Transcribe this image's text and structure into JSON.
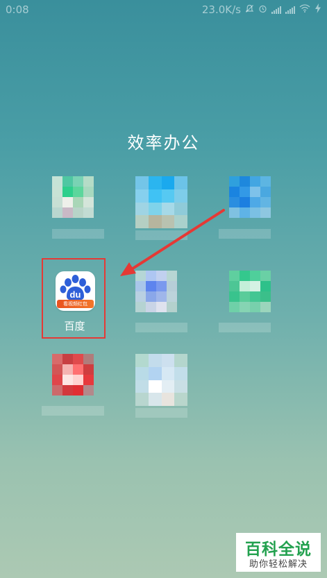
{
  "status_bar": {
    "time": "0:08",
    "network_speed": "23.0K/s",
    "icons": [
      "mute-icon",
      "alarm-icon",
      "signal-icon",
      "signal-icon",
      "wifi-icon",
      "charging-icon"
    ]
  },
  "folder": {
    "title": "效率办公"
  },
  "apps": {
    "baidu": {
      "label": "百度",
      "logo_text": "du",
      "banner_text": "看视频红包",
      "colors": {
        "paw": "#2e5fd8",
        "banner": "#ef6424"
      }
    },
    "pixelated": [
      {
        "name": "app-1",
        "colors": [
          "#c5e3d6",
          "#4fc7a2",
          "#79d3b4",
          "#b5dcc7",
          "#c8e2d5",
          "#2ecf8c",
          "#5cd69c",
          "#a8d9bf",
          "#c7dfd4",
          "#eef0ea",
          "#a9d6b7",
          "#d4e5da",
          "#b9d6cf",
          "#c9b9c6",
          "#b8d4c8",
          "#c2dcd3"
        ]
      },
      {
        "name": "app-2",
        "colors": [
          "#74c5e8",
          "#2bb5ef",
          "#1aa9ee",
          "#6cc3e8",
          "#86d0ee",
          "#40c2f4",
          "#56c9f2",
          "#7ecdea",
          "#9fd4e4",
          "#7fd3ea",
          "#a6d9e8",
          "#8fcbd9",
          "#b5cfc3",
          "#b6b59e",
          "#b9c2b0",
          "#aad1cc"
        ]
      },
      {
        "name": "app-3",
        "colors": [
          "#2fa0dd",
          "#1e88dd",
          "#43a6e2",
          "#5db5e2",
          "#1a84e0",
          "#3399e6",
          "#7ec2ea",
          "#4aa8e0",
          "#2a8ee0",
          "#1c7fe0",
          "#4ea9e6",
          "#62b5e3",
          "#7fc1e1",
          "#5fb3e6",
          "#7bc0e3",
          "#8ec7e0"
        ]
      },
      {
        "name": "app-4",
        "colors": [
          "#b5d6d6",
          "#aec6f2",
          "#c1d0ef",
          "#b7d6d3",
          "#a9c6ea",
          "#5d84ee",
          "#7a99ee",
          "#b7ced8",
          "#b9d0e2",
          "#8aa7e9",
          "#9fb6ea",
          "#bcd3db",
          "#b5d3d2",
          "#c9d4e6",
          "#dfe2ee",
          "#b4d1cd"
        ]
      },
      {
        "name": "app-5",
        "colors": [
          "#5fcf9f",
          "#34c88d",
          "#4fcf9b",
          "#6ad0a5",
          "#4dc695",
          "#c4efd9",
          "#d5f2e4",
          "#2ec18a",
          "#39c38d",
          "#5acc9a",
          "#43c693",
          "#3bbf8a",
          "#6fd0a8",
          "#86d4b3",
          "#78d0ac",
          "#9bd5bc"
        ]
      },
      {
        "name": "app-6",
        "colors": [
          "#d86a6a",
          "#c83f42",
          "#e04a4c",
          "#b07c7b",
          "#d35556",
          "#f5b3b1",
          "#ff7071",
          "#cf3d3f",
          "#e0464a",
          "#fde6e3",
          "#ffd2cf",
          "#e7393d",
          "#cc6a6b",
          "#d3393d",
          "#e02e33",
          "#b3888a"
        ]
      },
      {
        "name": "app-7",
        "colors": [
          "#b3d9cf",
          "#c3dcec",
          "#cde0ef",
          "#b4d6cd",
          "#b9dbe7",
          "#b2d3f1",
          "#d6e8f4",
          "#c2deea",
          "#c1dde7",
          "#ffffff",
          "#e3eef4",
          "#c9dfe5",
          "#b8d6cf",
          "#d8e6eb",
          "#e8e4de",
          "#b9d6cc"
        ]
      }
    ]
  },
  "watermark": {
    "title": "百科全说",
    "subtitle": "助你轻松解决"
  }
}
